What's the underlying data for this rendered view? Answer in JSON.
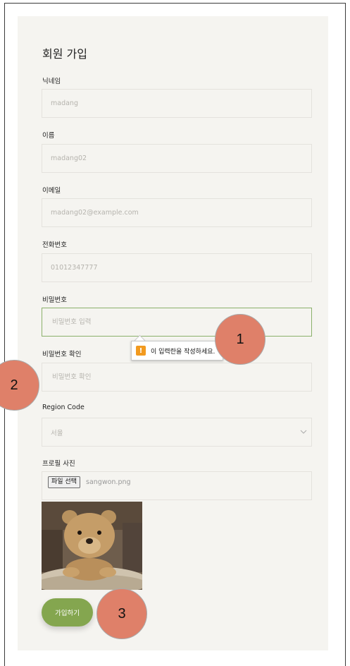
{
  "form": {
    "title": "회원 가입",
    "nickname": {
      "label": "닉네임",
      "value": "madang"
    },
    "name": {
      "label": "이름",
      "value": "madang02"
    },
    "email": {
      "label": "이메일",
      "value": "madang02@example.com"
    },
    "phone": {
      "label": "전화번호",
      "value": "01012347777"
    },
    "password": {
      "label": "비밀번호",
      "placeholder": "비밀번호 입력"
    },
    "password_confirm": {
      "label": "비밀번호 확인",
      "placeholder": "비밀번호 확인"
    },
    "region": {
      "label": "Region Code",
      "selected": "서울"
    },
    "profile_photo": {
      "label": "프로필 사진",
      "button_label": "파일 선택",
      "file_name": "sangwon.png"
    },
    "submit_label": "가입하기"
  },
  "validation_tooltip": {
    "text": "이 입력란을 작성하세요.",
    "icon": "warning-icon",
    "icon_color": "#f29a1f"
  },
  "markers": {
    "m1": "1",
    "m2": "2",
    "m3": "3"
  },
  "colors": {
    "accent": "#84a64f",
    "marker": "#df8069",
    "panel": "#f5f4f0"
  }
}
